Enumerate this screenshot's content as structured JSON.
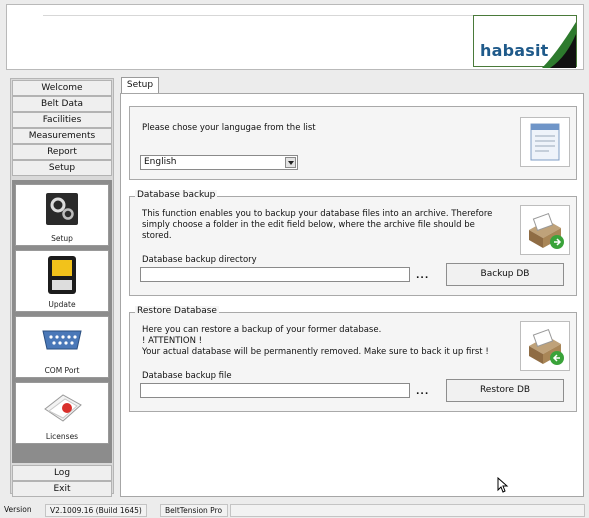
{
  "header": {
    "brand": "habasit"
  },
  "nav": {
    "buttons": [
      "Welcome",
      "Belt Data",
      "Facilities",
      "Measurements",
      "Report",
      "Setup"
    ],
    "tiles": [
      {
        "label": "Setup",
        "icon": "gears-icon"
      },
      {
        "label": "Update",
        "icon": "memory-card-icon"
      },
      {
        "label": "COM Port",
        "icon": "serial-port-icon"
      },
      {
        "label": "Licenses",
        "icon": "certificate-icon"
      }
    ],
    "bottom": [
      "Log",
      "Exit"
    ]
  },
  "tab": {
    "label": "Setup"
  },
  "language": {
    "prompt": "Please chose your langugae from the list",
    "selected": "English"
  },
  "backup": {
    "title": "Database backup",
    "description_lines": [
      "This function enables you to backup your database files into an archive. Therefore",
      "simply choose a folder in the edit field below, where the archive file should be",
      "stored."
    ],
    "field_label": "Database backup directory",
    "value": "",
    "browse": "...",
    "button": "Backup DB"
  },
  "restore": {
    "title": "Restore Database",
    "description_lines": [
      "Here you can restore a backup of your former database.",
      "! ATTENTION !",
      "Your actual database will be permanently removed. Make sure to back it up first !"
    ],
    "field_label": "Database backup file",
    "value": "",
    "browse": "...",
    "button": "Restore DB"
  },
  "status": {
    "version_label": "Version",
    "version": "V2.1009.16 (Build 1645)",
    "product": "BeltTension Pro"
  },
  "colors": {
    "brand_green": "#2d7a2d",
    "brand_blue": "#1f5a8a"
  }
}
